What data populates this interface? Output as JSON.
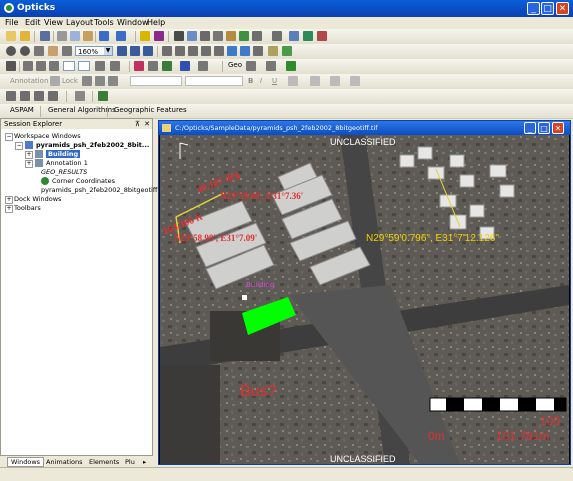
{
  "window": {
    "title": "Opticks",
    "min": "_",
    "max": "□",
    "close": "✕"
  },
  "menu": [
    "File",
    "Edit",
    "View",
    "Layout",
    "Tools",
    "Window",
    "Help"
  ],
  "toolbar2": {
    "zoom": "160%"
  },
  "toolbar4": {
    "annotation_label": "Annotation",
    "lock_label": "Lock",
    "bold": "B",
    "italic": "I",
    "underline": "U"
  },
  "toolbar3": {
    "geo_label": "Geo"
  },
  "plugin_tabs": [
    "ASPAM",
    "General Algorithms",
    "Geographic Features"
  ],
  "session_explorer": {
    "title": "Session Explorer",
    "pin": "⊼",
    "close": "✕",
    "tree": {
      "workspace": "Workspace Windows",
      "view": "pyramids_psh_2feb2002_8bit...",
      "building": "Building",
      "annotation": "Annotation 1",
      "geo_results": "GEO_RESULTS",
      "corner": "Corner Coordinates",
      "raster": "pyramids_psh_2feb2002_8bitgeotiff.tif",
      "dock": "Dock Windows",
      "toolbars": "Toolbars"
    },
    "tabs": [
      "Windows",
      "Animations",
      "Elements",
      "Plu"
    ]
  },
  "document": {
    "title": "C:/Opticks/SampleData/pyramids_psh_2feb2002_8bitgeotiff.tif",
    "classification_top": "UNCLASSIFIED",
    "classification_bottom": "UNCLASSIFIED",
    "annotations": {
      "measure1": "49.187 deg",
      "measure2": "164.396 ft",
      "coord1": "N29°59.00', E31°7.36'",
      "coord2": "N29°58.98', E31°7.09'",
      "coord_right": "N29°59'0.796\", E31°7'12.126\"",
      "purple": "Building",
      "bus": "Bus?",
      "scale_left": "0m",
      "scale_right": "101.781m",
      "scale_top_right": "100"
    }
  }
}
